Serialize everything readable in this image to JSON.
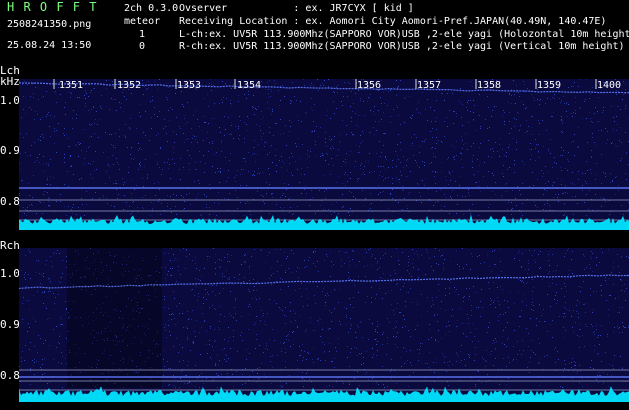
{
  "header": {
    "logo": "H R O F F T",
    "filename": "2508241350.png",
    "datetime": "25.08.24 13:50",
    "mode": "2ch 0.3.0",
    "meteor_label": "meteor",
    "lch_count": "1",
    "rch_count": "0",
    "info_lines": [
      "Ovserver           : ex. JR7CYX [ kid ]",
      "Receiving Location : ex. Aomori City Aomori-Pref.JAPAN(40.49N, 140.47E)",
      "L-ch:ex. UV5R 113.900Mhz(SAPPORO VOR)USB ,2-ele yagi (Holozontal 10m height)",
      "R-ch:ex. UV5R 113.900Mhz(SAPPORO VOR)USB ,2-ele yagi (Vertical 10m height)"
    ]
  },
  "lch": {
    "label": "Lch",
    "unit": "kHz",
    "ticks": [
      "1.0",
      "0.9",
      "0.8"
    ],
    "time_labels": [
      "1351",
      "1352",
      "1353",
      "1354",
      "1356",
      "1357",
      "1358",
      "1359",
      "1400"
    ]
  },
  "rch": {
    "label": "Rch",
    "ticks": [
      "1.0",
      "0.9",
      "0.8"
    ]
  },
  "colors": {
    "background": "#000000",
    "panel": "#0a0a3e",
    "noise": "#3b5cff",
    "trace": "#5f7bff",
    "signal": "#00e5ff",
    "logo": "#7dff7d"
  }
}
